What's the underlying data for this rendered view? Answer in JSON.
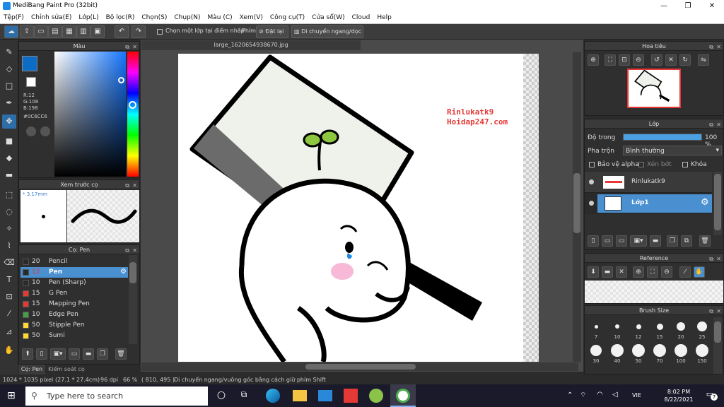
{
  "window": {
    "title": "MediBang Paint Pro (32bit)"
  },
  "menu": [
    "Tệp(F)",
    "Chỉnh sửa(E)",
    "Lớp(L)",
    "Bộ lọc(R)",
    "Chọn(S)",
    "Chụp(N)",
    "Màu (C)",
    "Xem(V)",
    "Công cụ(T)",
    "Cửa sổ(W)",
    "Cloud",
    "Help"
  ],
  "toolbar": {
    "select_layer_label": "Chọn một lớp tại điểm nhấp",
    "key_label": "Phím",
    "reset_label": "Đặt lại",
    "move_label": "Di chuyển ngang/dọc"
  },
  "color_panel": {
    "title": "Màu",
    "r": "R:12",
    "g": "G:108",
    "b": "B:198",
    "hex": "#0C6CC6",
    "color": "#0C6CC6"
  },
  "preview_panel": {
    "title": "Xem trước cọ",
    "size": "3.17mm"
  },
  "brush_panel": {
    "title": "Cọ: Pen",
    "items": [
      {
        "size": "20",
        "name": "Pencil",
        "color": "#2a2a2a"
      },
      {
        "size": "12",
        "name": "Pen",
        "color": "#2a2a2a",
        "selected": true
      },
      {
        "size": "10",
        "name": "Pen (Sharp)",
        "color": "#2a2a2a"
      },
      {
        "size": "15",
        "name": "G Pen",
        "color": "#e53935"
      },
      {
        "size": "15",
        "name": "Mapping Pen",
        "color": "#e53935"
      },
      {
        "size": "10",
        "name": "Edge Pen",
        "color": "#43a047"
      },
      {
        "size": "50",
        "name": "Stipple Pen",
        "color": "#fdd835"
      },
      {
        "size": "50",
        "name": "Sumi",
        "color": "#fdd835"
      }
    ],
    "tabs": [
      "Cọ: Pen",
      "Kiểm soát cọ"
    ]
  },
  "document": {
    "tab": "large_1620654938670.jpg"
  },
  "artwork": {
    "watermark1": "Rinlukatk9",
    "watermark2": "Hoidap247.com"
  },
  "navigator": {
    "title": "Hoa tiêu"
  },
  "layers": {
    "title": "Lớp",
    "opacity_label": "Độ trong",
    "opacity_value": "100 %",
    "opacity": 1.0,
    "blend_label": "Pha trộn",
    "blend_value": "Bình thường",
    "protect_alpha": "Bảo vệ alpha",
    "clip": "Xén bớt",
    "lock": "Khóa",
    "items": [
      {
        "name": "Rinlukatk9",
        "selected": false
      },
      {
        "name": "Lớp1",
        "selected": true
      }
    ]
  },
  "reference": {
    "title": "Reference"
  },
  "brush_size": {
    "title": "Brush Size",
    "sizes": [
      "7",
      "10",
      "12",
      "15",
      "20",
      "25",
      "30",
      "40",
      "50",
      "70",
      "100",
      "150"
    ]
  },
  "status": {
    "size": "1024 * 1035 pixel",
    "cm": "(27.1 * 27.4cm)",
    "dpi": "96 dpi",
    "zoom": "66 %",
    "coords": "( 810, 495 )",
    "hint": "Di chuyển ngang/vuông góc bằng cách giữ phím Shift"
  },
  "taskbar": {
    "search_placeholder": "Type here to search",
    "time": "8:02 PM",
    "date": "8/22/2021",
    "lang": "VIE",
    "notif": "7"
  }
}
